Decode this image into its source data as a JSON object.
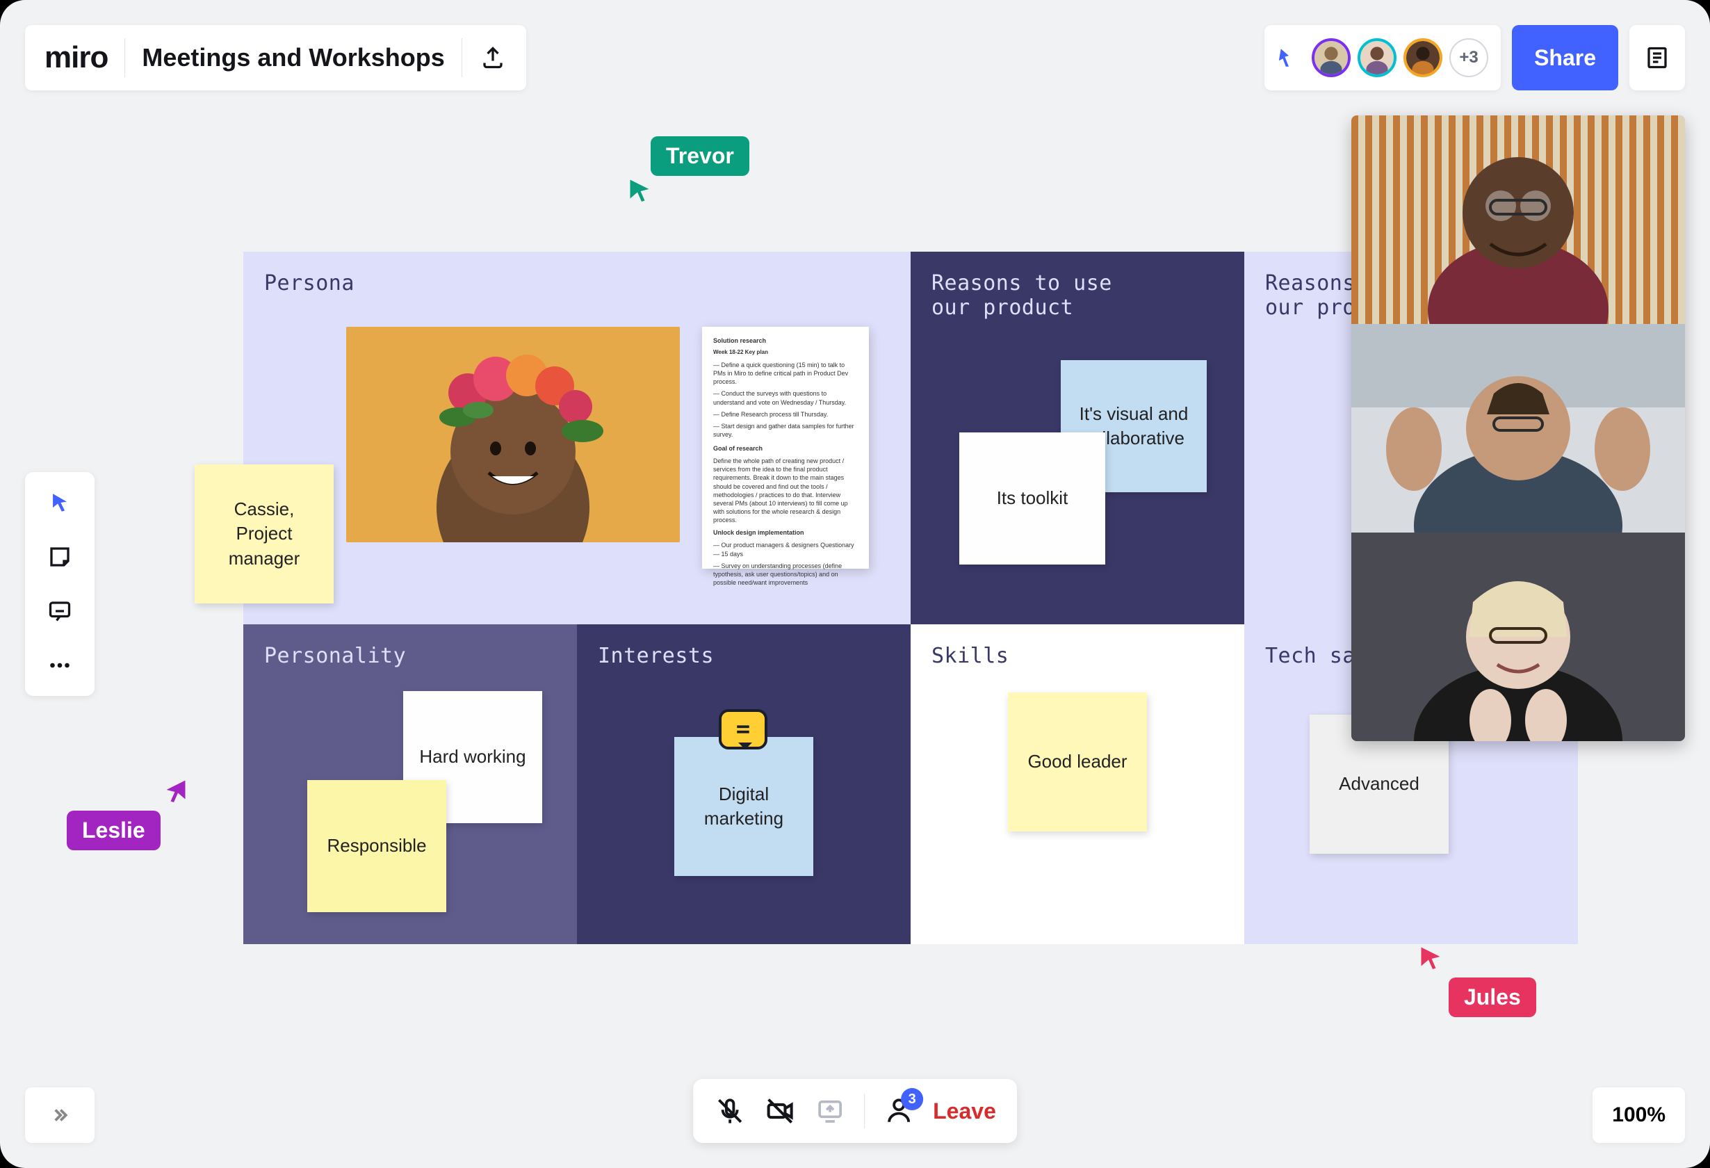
{
  "header": {
    "logo": "miro",
    "board_title": "Meetings and Workshops",
    "share_label": "Share",
    "more_avatars": "+3"
  },
  "avatars": [
    {
      "ring": "#7b2ff2"
    },
    {
      "ring": "#00c1d4"
    },
    {
      "ring": "#f5a623"
    }
  ],
  "sections": {
    "persona": "Persona",
    "reasons1_l1": "Reasons to use",
    "reasons1_l2": "our product",
    "reasons2_l1": "Reasons to use",
    "reasons2_l2": "our product",
    "personality": "Personality",
    "interests": "Interests",
    "skills": "Skills",
    "tech": "Tech savviness"
  },
  "stickies": {
    "cassie": "Cassie,\nProject\nmanager",
    "visual": "It's visual and collaborative",
    "toolkit": "Its toolkit",
    "hardworking": "Hard working",
    "responsible": "Responsible",
    "digital": "Digital marketing",
    "goodleader": "Good leader",
    "advanced": "Advanced"
  },
  "doc": {
    "h1": "Solution research",
    "h2": "Week 18-22 Key plan",
    "p1": "— Define a quick questioning (15 min) to talk to PMs in Miro to define critical path in Product Dev process.",
    "p2": "— Conduct the surveys with questions to understand and vote on Wednesday / Thursday.",
    "p3": "— Define Research process till Thursday.",
    "p4": "— Start design and gather data samples for further survey.",
    "h3": "Goal of research",
    "p5": "Define the whole path of creating new product / services from the idea to the final product requirements. Break it down to the main stages should be covered and find out the tools / methodologies / practices to do that. Interview several PMs (about 10 interviews) to fill come up with solutions for the whole research & design process.",
    "h4": "Unlock design implementation",
    "p6": "— Our product managers & designers Questionary — 15 days",
    "p7": "— Survey on understanding processes (define typothesis, ask user questions/topics) and on possible need/want improvements"
  },
  "cursors": {
    "trevor": "Trevor",
    "leslie": "Leslie",
    "jules": "Jules"
  },
  "colors": {
    "trevor": "#0a9e7f",
    "leslie": "#a225c2",
    "jules": "#e7335f"
  },
  "call": {
    "reactions_badge": "3",
    "leave": "Leave"
  },
  "zoom": "100%"
}
